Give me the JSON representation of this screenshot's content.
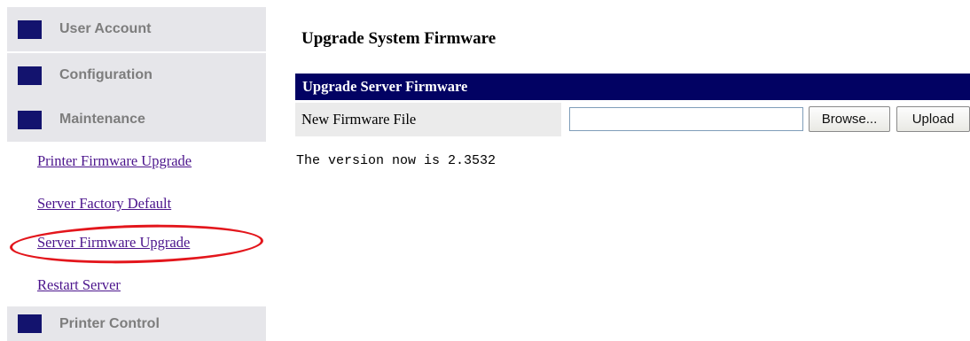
{
  "sidebar": {
    "sections": [
      {
        "label": "User Account"
      },
      {
        "label": "Configuration"
      },
      {
        "label": "Maintenance"
      },
      {
        "label": "Printer Control"
      }
    ],
    "maintenance_links": [
      {
        "label": "Printer Firmware Upgrade"
      },
      {
        "label": "Server Factory Default"
      },
      {
        "label": "Server Firmware Upgrade"
      },
      {
        "label": "Restart Server"
      }
    ]
  },
  "main": {
    "title": "Upgrade System Firmware",
    "section_header": "Upgrade Server Firmware",
    "file_field_label": "New Firmware File",
    "file_input_value": "",
    "browse_label": "Browse...",
    "upload_label": "Upload",
    "version_text": "The version now is 2.3532"
  },
  "colors": {
    "accent_navy": "#020263",
    "nav_square": "#13136e",
    "link": "#4b148c",
    "highlight": "#e3161c"
  }
}
